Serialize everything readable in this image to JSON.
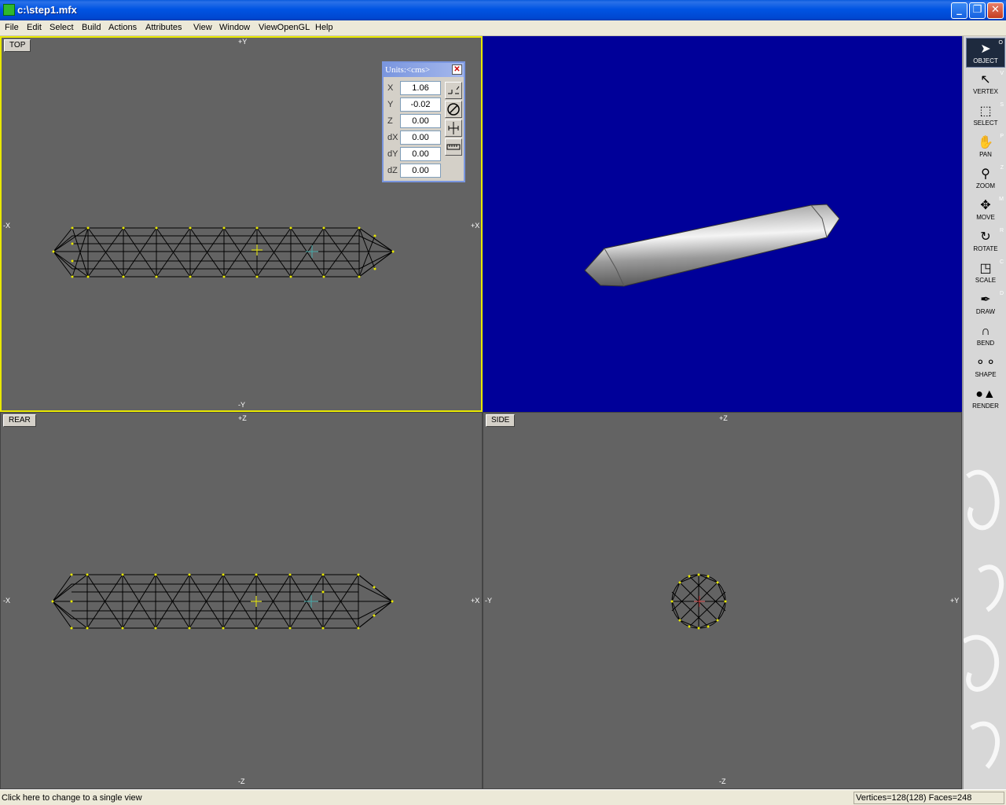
{
  "window": {
    "title": "c:\\step1.mfx"
  },
  "menu": [
    "File",
    "Edit",
    "Select",
    "Build",
    "Actions",
    "Attributes",
    "View",
    "Window",
    "ViewOpenGL",
    "Help"
  ],
  "viewports": {
    "top": {
      "label": "TOP",
      "axis_top": "+Y",
      "axis_bottom": "-Y",
      "axis_left": "-X",
      "axis_right": "+X"
    },
    "rear": {
      "label": "REAR",
      "axis_top": "+Z",
      "axis_bottom": "-Z",
      "axis_left": "-X",
      "axis_right": "+X"
    },
    "side": {
      "label": "SIDE",
      "axis_top": "+Z",
      "axis_bottom": "-Z",
      "axis_left": "-Y",
      "axis_right": "+Y"
    }
  },
  "units_dialog": {
    "title": "Units:<cms>",
    "rows": [
      {
        "label": "X",
        "value": "1.06"
      },
      {
        "label": "Y",
        "value": "-0.02"
      },
      {
        "label": "Z",
        "value": "0.00"
      },
      {
        "label": "dX",
        "value": "0.00"
      },
      {
        "label": "dY",
        "value": "0.00"
      },
      {
        "label": "dZ",
        "value": "0.00"
      }
    ]
  },
  "tools": [
    {
      "name": "OBJECT",
      "key": "O",
      "icon": "arrow-cursor-icon"
    },
    {
      "name": "VERTEX",
      "key": "V",
      "icon": "vertex-arrow-icon"
    },
    {
      "name": "SELECT",
      "key": "S",
      "icon": "marquee-select-icon"
    },
    {
      "name": "PAN",
      "key": "P",
      "icon": "hand-icon"
    },
    {
      "name": "ZOOM",
      "key": "Z",
      "icon": "magnifier-icon"
    },
    {
      "name": "MOVE",
      "key": "M",
      "icon": "move-arrows-icon"
    },
    {
      "name": "ROTATE",
      "key": "R",
      "icon": "rotate-icon"
    },
    {
      "name": "SCALE",
      "key": "C",
      "icon": "scale-icon"
    },
    {
      "name": "DRAW",
      "key": "D",
      "icon": "pen-icon"
    },
    {
      "name": "BEND",
      "key": "",
      "icon": "magnet-icon"
    },
    {
      "name": "SHAPE",
      "key": "",
      "icon": "shapes-icon"
    },
    {
      "name": "RENDER",
      "key": "",
      "icon": "render-spheres-icon"
    }
  ],
  "status": {
    "hint": "Click here to change to a single view",
    "counts": "Vertices=128(128) Faces=248"
  },
  "colors": {
    "viewport_bg": "#636363",
    "opengl_bg": "#000099",
    "active_border": "#e8e800",
    "vertex": "#e8e800"
  }
}
